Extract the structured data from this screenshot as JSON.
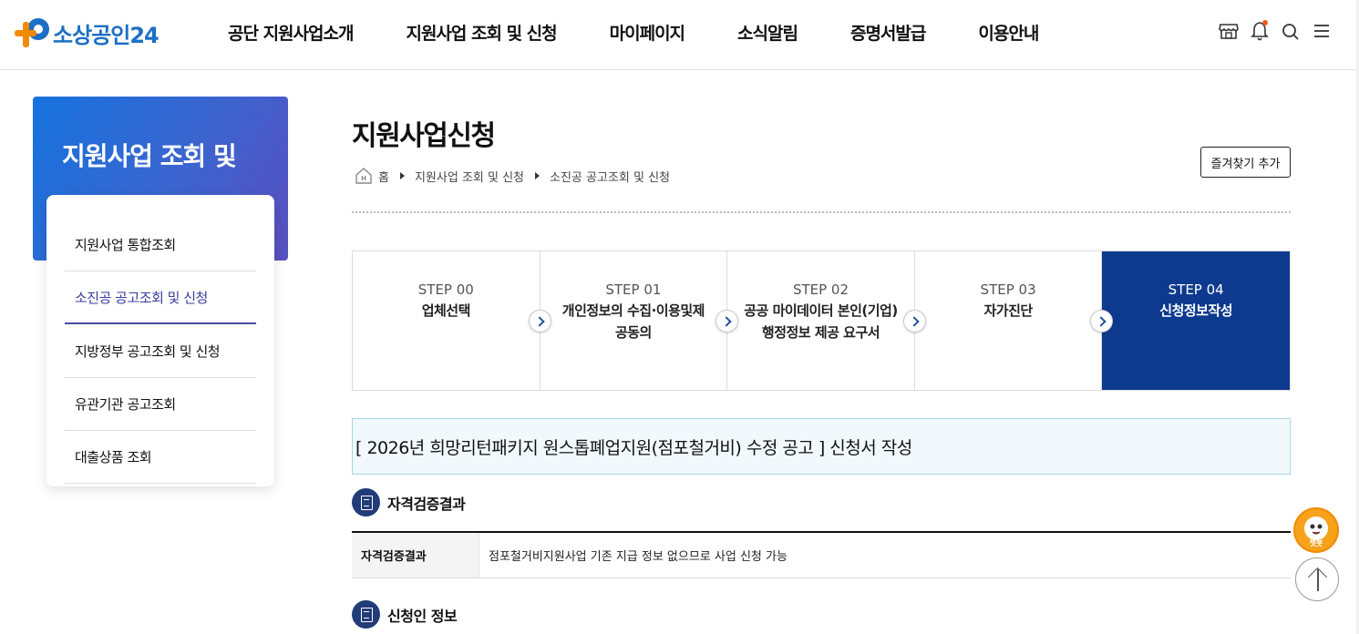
{
  "logo": {
    "text": "소상공인24"
  },
  "gnb": [
    "공단 지원사업소개",
    "지원사업 조회 및 신청",
    "마이페이지",
    "소식알림",
    "증명서발급",
    "이용안내"
  ],
  "utility_icons": [
    "store-icon",
    "bell-icon",
    "search-icon",
    "menu-icon"
  ],
  "sidebar": {
    "title": "지원사업 조회 및",
    "items": [
      "지원사업 통합조회",
      "소진공 공고조회 및 신청",
      "지방정부 공고조회 및 신청",
      "유관기관 공고조회",
      "대출상품 조회"
    ],
    "active_index": 1
  },
  "page": {
    "title": "지원사업신청",
    "favorite_label": "즐겨찾기 추가",
    "breadcrumb": [
      "홈",
      "지원사업 조회 및 신청",
      "소진공 공고조회 및 신청"
    ]
  },
  "steps": [
    {
      "no": "STEP 00",
      "name": "업체선택"
    },
    {
      "no": "STEP 01",
      "name": "개인정보의 수집·이용및제공동의"
    },
    {
      "no": "STEP 02",
      "name": "공공 마이데이터 본인(기업) 행정정보 제공 요구서"
    },
    {
      "no": "STEP 03",
      "name": "자가진단"
    },
    {
      "no": "STEP 04",
      "name": "신청정보작성"
    }
  ],
  "active_step": 4,
  "notice": "[ 2026년 희망리턴패키지 원스톱폐업지원(점포철거비) 수정 공고 ] 신청서 작성",
  "sections": {
    "qualification": {
      "title": "자격검증결과",
      "row_label": "자격검증결과",
      "row_value": "점포철거비지원사업 기존 지급 정보 없으므로 사업 신청 가능"
    },
    "applicant": {
      "title": "신청인 정보"
    }
  },
  "floating": {
    "chatbot_label": "챗봇"
  },
  "colors": {
    "brand": "#1c6fc4",
    "orange": "#f28a00",
    "active_step": "#0d3a8e",
    "side_accent": "#4a4aa8"
  }
}
